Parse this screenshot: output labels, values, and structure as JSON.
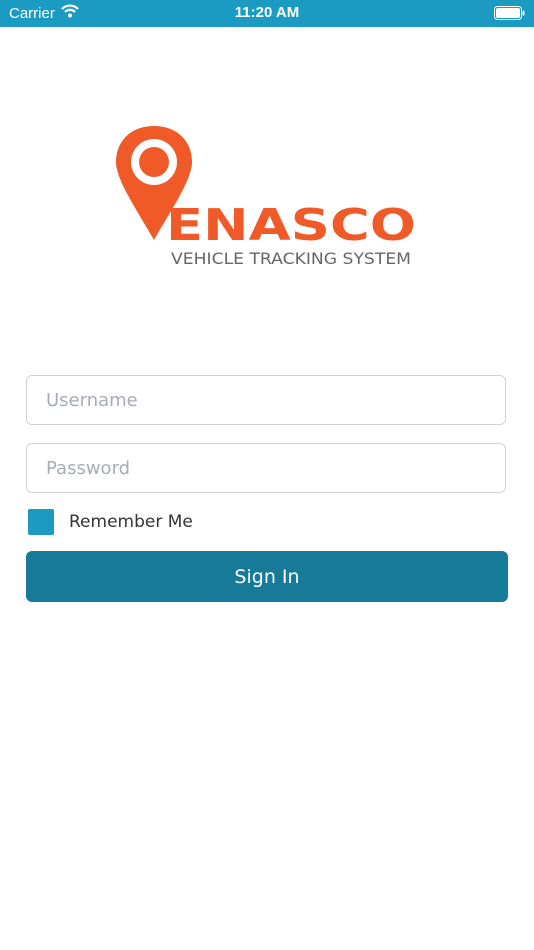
{
  "status_bar": {
    "carrier": "Carrier",
    "time": "11:20 AM"
  },
  "logo": {
    "brand_letter": "V",
    "brand_text": "ENASCO",
    "tagline": "VEHICLE TRACKING SYSTEM",
    "color": "#f05a28"
  },
  "form": {
    "username_placeholder": "Username",
    "password_placeholder": "Password",
    "remember_label": "Remember Me",
    "remember_checked": true,
    "signin_label": "Sign In"
  },
  "colors": {
    "status_bar": "#1b9bc2",
    "checkbox": "#1b9bc2",
    "button": "#177a99",
    "brand": "#f05a28"
  }
}
